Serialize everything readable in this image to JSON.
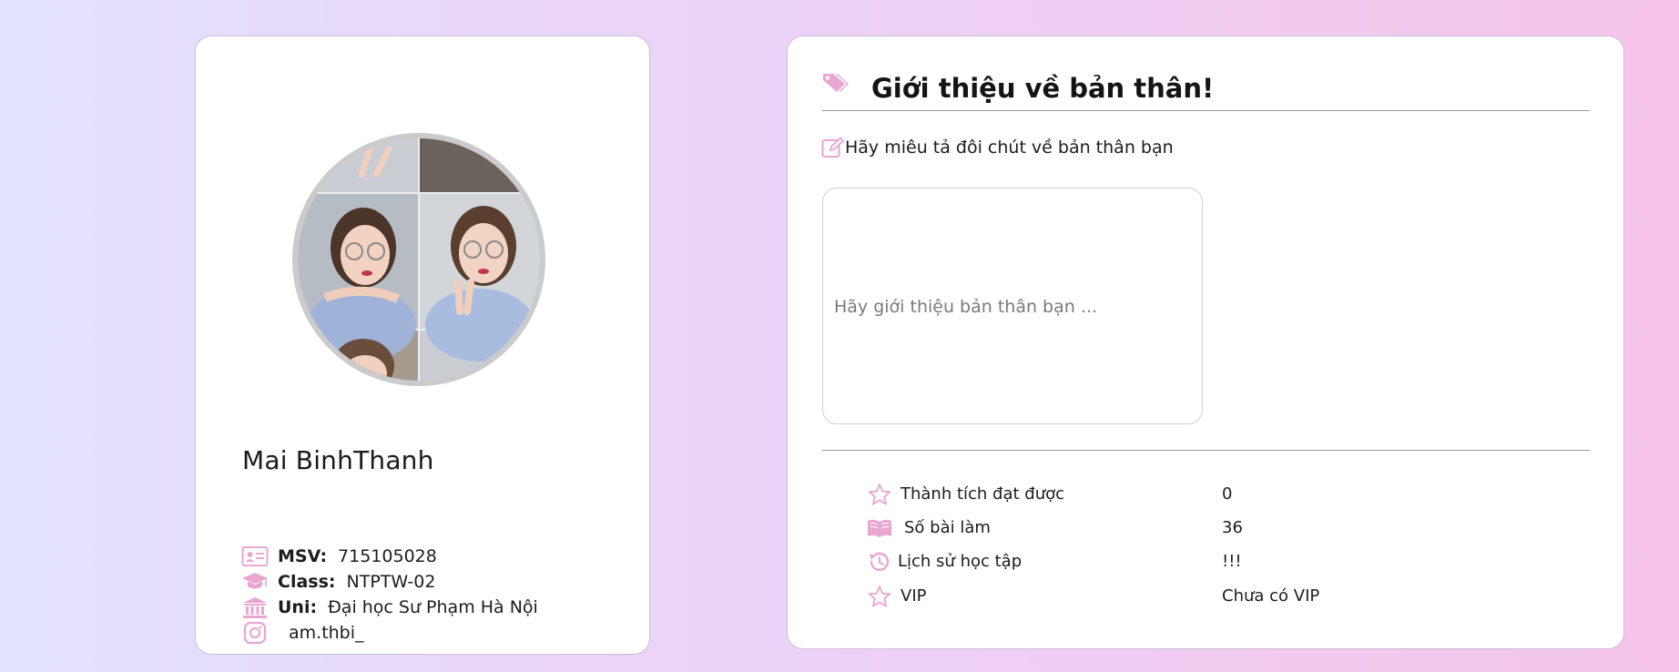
{
  "theme": {
    "accent": "#e9a6cf",
    "card_bg": "#ffffff",
    "page_gradient": [
      "#e2e3fd",
      "#f6c4ea"
    ]
  },
  "profile": {
    "name": "Mai BinhThanh",
    "avatar": "profile-photo-collage",
    "info": [
      {
        "icon": "id-card-icon",
        "label": "MSV:",
        "value": "715105028"
      },
      {
        "icon": "graduation-cap-icon",
        "label": "Class:",
        "value": "NTPTW-02"
      },
      {
        "icon": "university-icon",
        "label": "Uni:",
        "value": "Đại học Sư Phạm Hà Nội"
      },
      {
        "icon": "instagram-icon",
        "label": "",
        "value": "am.thbi_"
      }
    ]
  },
  "intro": {
    "title_icon": "tag-icon",
    "title": "Giới thiệu về bản thân!",
    "prompt_icon": "edit-icon",
    "prompt": "Hãy miêu tả đôi chút về bản thân bạn",
    "textarea_value": "",
    "textarea_placeholder": "Hãy giới thiệu bản thân bạn ...",
    "stats": [
      {
        "icon": "star-icon",
        "label": "Thành tích đạt được",
        "value": "0"
      },
      {
        "icon": "book-icon",
        "label": "Số bài làm",
        "value": "36"
      },
      {
        "icon": "history-icon",
        "label": "Lịch sử học tập",
        "value": "!!!"
      },
      {
        "icon": "star-icon",
        "label": "VIP",
        "value": "Chưa có VIP"
      }
    ]
  }
}
